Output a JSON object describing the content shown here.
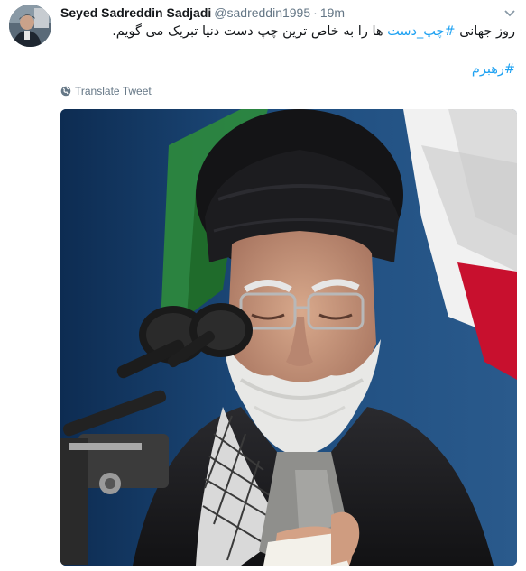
{
  "tweet": {
    "author": {
      "name": "Seyed Sadreddin Sadjadi",
      "handle": "@sadreddin1995",
      "separator": "·",
      "time": "19m"
    },
    "text": {
      "line1_part1": "روز جهانی",
      "hashtag1": "#چپ_دست",
      "line1_part2": "ها را به خاص ترین چپ دست دنیا تبریک می گویم.",
      "hashtag2": "#رهبرم"
    },
    "translate_label": "Translate Tweet",
    "icons": {
      "more": "chevron-down-icon",
      "translate": "globe-icon"
    },
    "colors": {
      "link": "#1da1f2",
      "secondary_text": "#657786",
      "primary_text": "#14171a"
    }
  }
}
